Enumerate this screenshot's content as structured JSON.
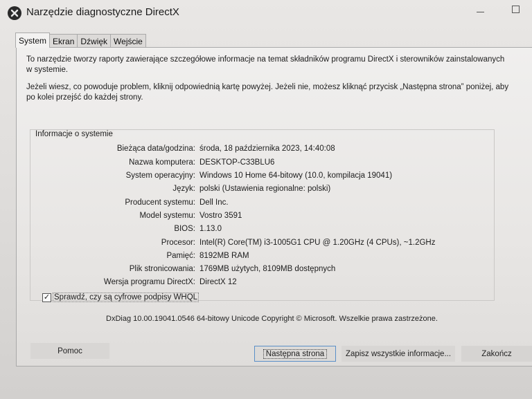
{
  "window": {
    "title": "Narzędzie diagnostyczne DirectX"
  },
  "tabs": [
    {
      "label": "System",
      "active": true
    },
    {
      "label": "Ekran",
      "active": false
    },
    {
      "label": "Dźwięk",
      "active": false
    },
    {
      "label": "Wejście",
      "active": false
    }
  ],
  "intro": {
    "line1": "To narzędzie tworzy raporty zawierające szczegółowe informacje na temat składników programu DirectX i sterowników zainstalowanych w systemie.",
    "line2": "Jeżeli wiesz, co powoduje problem, kliknij odpowiednią kartę powyżej. Jeżeli nie, możesz kliknąć przycisk „Następna strona” poniżej, aby po kolei przejść do każdej strony."
  },
  "system_info": {
    "group_label": "Informacje o systemie",
    "rows": [
      {
        "label": "Bieżąca data/godzina:",
        "value": "środa, 18 października 2023, 14:40:08"
      },
      {
        "label": "Nazwa komputera:",
        "value": "DESKTOP-C33BLU6"
      },
      {
        "label": "System operacyjny:",
        "value": "Windows 10 Home 64-bitowy (10.0, kompilacja 19041)"
      },
      {
        "label": "Język:",
        "value": "polski (Ustawienia regionalne: polski)"
      },
      {
        "label": "Producent systemu:",
        "value": "Dell Inc."
      },
      {
        "label": "Model systemu:",
        "value": "Vostro 3591"
      },
      {
        "label": "BIOS:",
        "value": "1.13.0"
      },
      {
        "label": "Procesor:",
        "value": "Intel(R) Core(TM) i3-1005G1 CPU @ 1.20GHz (4 CPUs), ~1.2GHz"
      },
      {
        "label": "Pamięć:",
        "value": "8192MB RAM"
      },
      {
        "label": "Plik stronicowania:",
        "value": "1769MB użytych, 8109MB dostępnych"
      },
      {
        "label": "Wersja programu DirectX:",
        "value": "DirectX 12"
      }
    ]
  },
  "whql_check": {
    "label": "Sprawdź, czy są cyfrowe podpisy WHQL",
    "checked": true,
    "mark": "✓"
  },
  "footer": {
    "copyright": "DxDiag 10.00.19041.0546 64-bitowy Unicode  Copyright © Microsoft. Wszelkie prawa zastrzeżone."
  },
  "buttons": {
    "help": "Pomoc",
    "next": "Następna strona",
    "save": "Zapisz wszystkie informacje...",
    "exit": "Zakończ"
  },
  "icons": {
    "app": "directx-x-icon",
    "minimize": "minimize-icon",
    "maximize": "maximize-icon"
  }
}
